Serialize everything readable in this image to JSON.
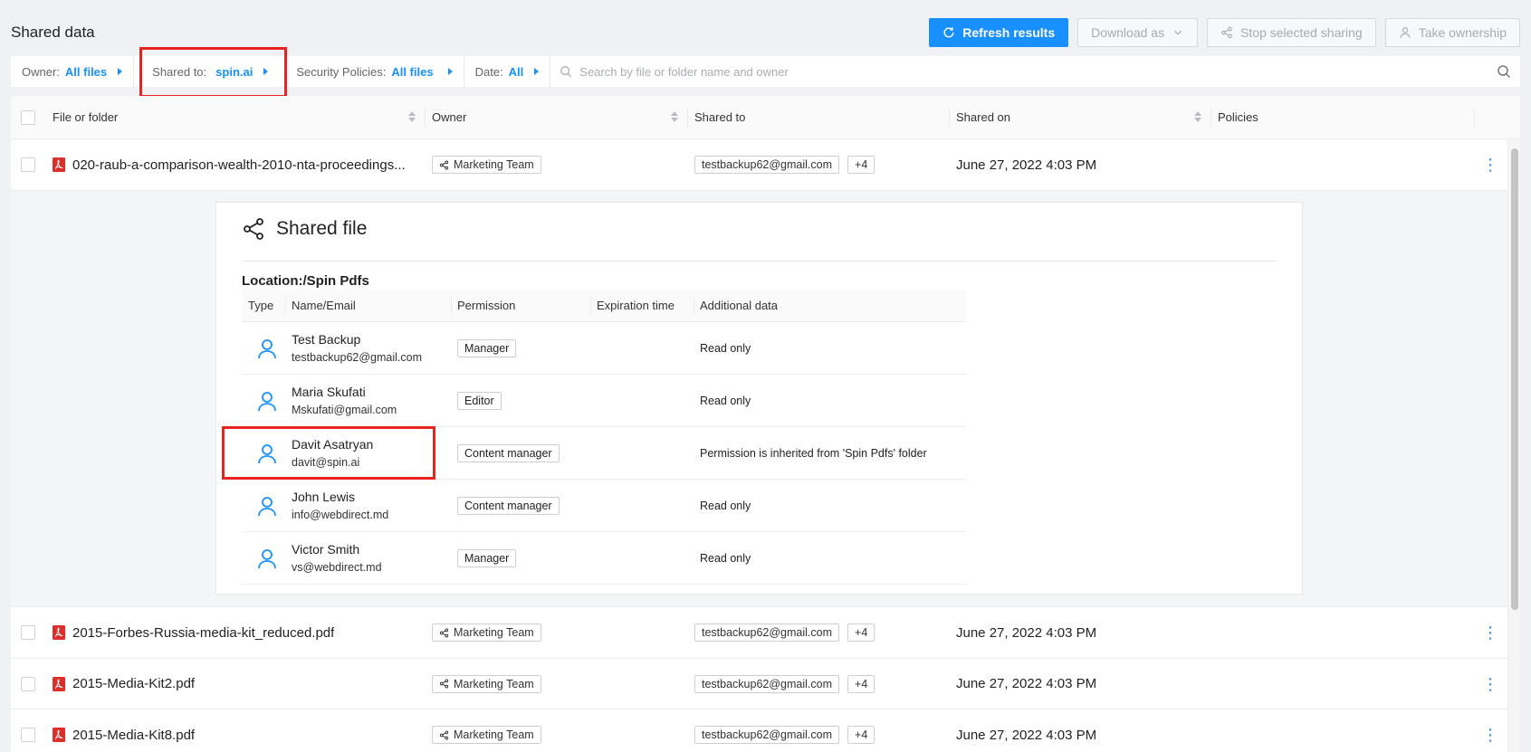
{
  "page_title": "Shared data",
  "toolbar": {
    "refresh_label": "Refresh results",
    "download_label": "Download as",
    "stop_label": "Stop selected sharing",
    "take_label": "Take ownership"
  },
  "filters": {
    "owner_label": "Owner:",
    "owner_value": "All files",
    "shared_label": "Shared to:",
    "shared_value": "spin.ai",
    "security_label": "Security Policies:",
    "security_value": "All files",
    "date_label": "Date:",
    "date_value": "All",
    "search_placeholder": "Search by file or folder name and owner"
  },
  "columns": {
    "file": "File or folder",
    "owner": "Owner",
    "shared_to": "Shared to",
    "shared_on": "Shared on",
    "policies": "Policies"
  },
  "rows": [
    {
      "file": "020-raub-a-comparison-wealth-2010-nta-proceedings...",
      "owner": "Marketing Team",
      "shared_to": "testbackup62@gmail.com",
      "more": "+4",
      "shared_on": "June 27, 2022 4:03 PM"
    },
    {
      "file": "2015-Forbes-Russia-media-kit_reduced.pdf",
      "owner": "Marketing Team",
      "shared_to": "testbackup62@gmail.com",
      "more": "+4",
      "shared_on": "June 27, 2022 4:03 PM"
    },
    {
      "file": "2015-Media-Kit2.pdf",
      "owner": "Marketing Team",
      "shared_to": "testbackup62@gmail.com",
      "more": "+4",
      "shared_on": "June 27, 2022 4:03 PM"
    },
    {
      "file": "2015-Media-Kit8.pdf",
      "owner": "Marketing Team",
      "shared_to": "testbackup62@gmail.com",
      "more": "+4",
      "shared_on": "June 27, 2022 4:03 PM"
    }
  ],
  "detail": {
    "title": "Shared file",
    "location": "Location:/Spin Pdfs",
    "columns": {
      "type": "Type",
      "name": "Name/Email",
      "permission": "Permission",
      "expiration": "Expiration time",
      "additional": "Additional data"
    },
    "users": [
      {
        "name": "Test Backup",
        "email": "testbackup62@gmail.com",
        "permission": "Manager",
        "additional": "Read only"
      },
      {
        "name": "Maria Skufati",
        "email": "Mskufati@gmail.com",
        "permission": "Editor",
        "additional": "Read only"
      },
      {
        "name": "Davit Asatryan",
        "email": "davit@spin.ai",
        "permission": "Content manager",
        "additional": "Permission is inherited from 'Spin Pdfs' folder"
      },
      {
        "name": "John Lewis",
        "email": "info@webdirect.md",
        "permission": "Content manager",
        "additional": "Read only"
      },
      {
        "name": "Victor Smith",
        "email": "vs@webdirect.md",
        "permission": "Manager",
        "additional": "Read only"
      }
    ]
  },
  "colors": {
    "accent": "#1890ff",
    "highlight": "#e8231f",
    "pdf_red": "#d9302c"
  }
}
